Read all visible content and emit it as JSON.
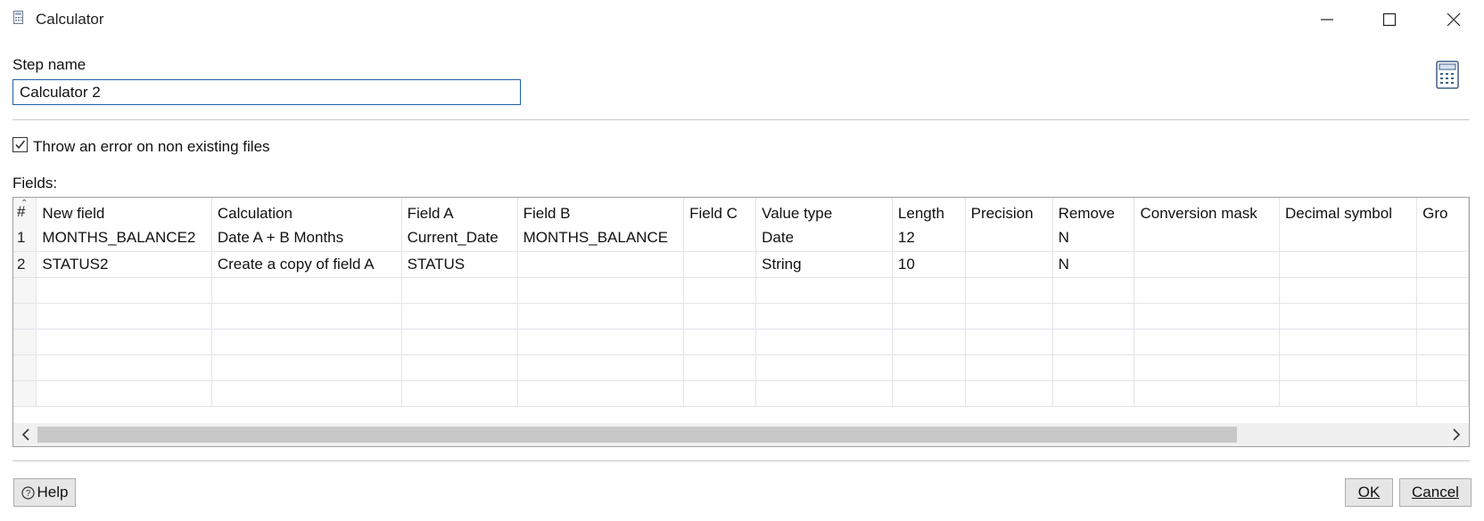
{
  "window": {
    "title": "Calculator",
    "icon": "calculator-icon",
    "controls": [
      "minimize-icon",
      "maximize-icon",
      "close-icon"
    ]
  },
  "step": {
    "label": "Step name",
    "value": "Calculator 2"
  },
  "options": {
    "throw_error_label": "Throw an error on non existing files",
    "throw_error_checked": true
  },
  "fields": {
    "label": "Fields:",
    "columns": [
      "#",
      "New field",
      "Calculation",
      "Field A",
      "Field B",
      "Field C",
      "Value type",
      "Length",
      "Precision",
      "Remove",
      "Conversion mask",
      "Decimal symbol",
      "Gro"
    ],
    "rows": [
      [
        "1",
        "MONTHS_BALANCE2",
        "Date A + B Months",
        "Current_Date",
        "MONTHS_BALANCE",
        "",
        "Date",
        "12",
        "",
        "N",
        "",
        "",
        ""
      ],
      [
        "2",
        "STATUS2",
        "Create a copy of field A",
        "STATUS",
        "",
        "",
        "String",
        "10",
        "",
        "N",
        "",
        "",
        ""
      ],
      [
        "",
        "",
        "",
        "",
        "",
        "",
        "",
        "",
        "",
        "",
        "",
        "",
        ""
      ],
      [
        "",
        "",
        "",
        "",
        "",
        "",
        "",
        "",
        "",
        "",
        "",
        "",
        ""
      ],
      [
        "",
        "",
        "",
        "",
        "",
        "",
        "",
        "",
        "",
        "",
        "",
        "",
        ""
      ],
      [
        "",
        "",
        "",
        "",
        "",
        "",
        "",
        "",
        "",
        "",
        "",
        "",
        ""
      ],
      [
        "",
        "",
        "",
        "",
        "",
        "",
        "",
        "",
        "",
        "",
        "",
        "",
        ""
      ]
    ]
  },
  "buttons": {
    "help": "Help",
    "ok": "OK",
    "cancel": "Cancel"
  },
  "colors": {
    "accent_border": "#1f5fa8",
    "button_bg": "#e6e6e6"
  }
}
